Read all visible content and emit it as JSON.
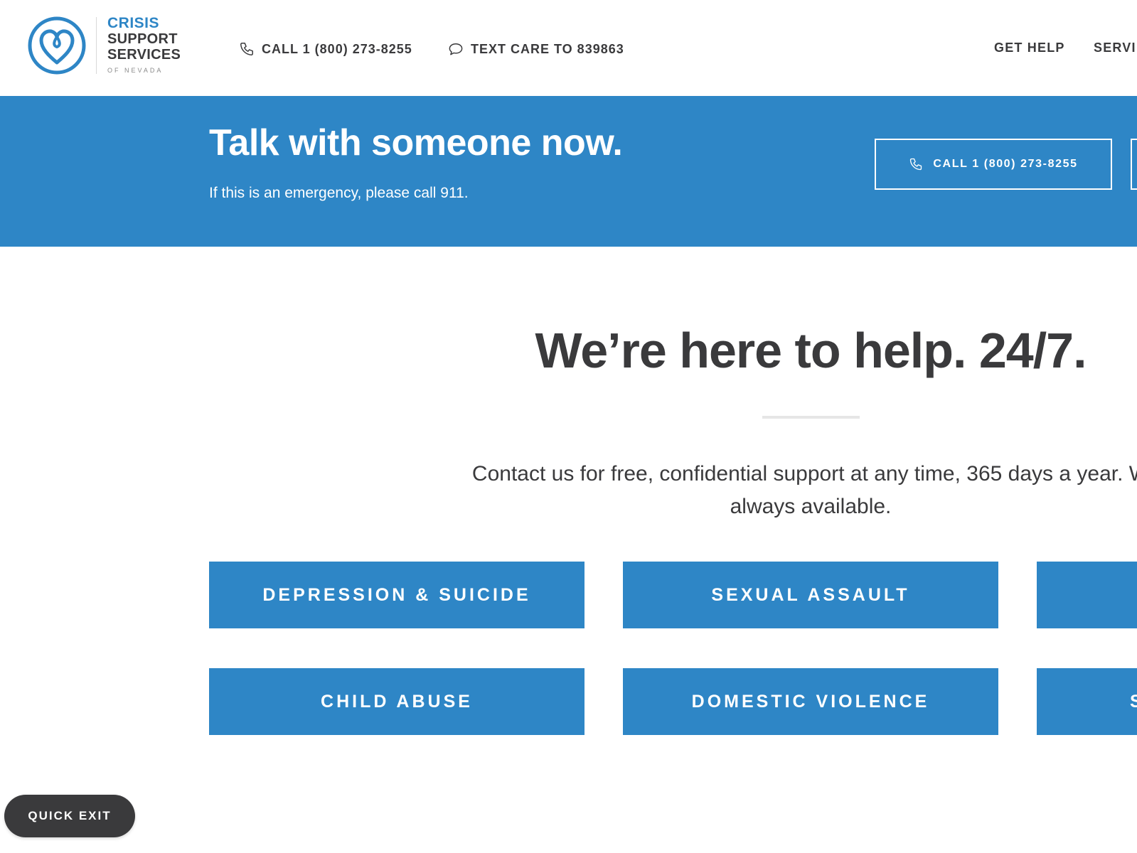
{
  "colors": {
    "brand_blue": "#2e86c6",
    "text_dark": "#3a3a3c",
    "white": "#ffffff",
    "divider": "#e6e6e6"
  },
  "logo": {
    "icon": "heart-circle-logo-icon",
    "line1": "CRISIS",
    "line2": "SUPPORT",
    "line3": "SERVICES",
    "line4": "OF NEVADA"
  },
  "header": {
    "call_icon": "phone-icon",
    "call_label": "CALL 1 (800) 273-8255",
    "text_icon": "chat-bubble-icon",
    "text_label": "TEXT CARE TO 839863",
    "nav": {
      "get_help": "GET HELP",
      "services": "SERVI"
    }
  },
  "banner": {
    "title": "Talk with someone now.",
    "subtitle": "If this is an emergency, please call 911.",
    "call_icon": "phone-icon",
    "call_button": "CALL 1 (800) 273-8255"
  },
  "main": {
    "title": "We’re here to help. 24/7.",
    "intro_line1": "Contact us for free, confidential support at any time, 365 days a year. W",
    "intro_line2": "always available.",
    "categories": [
      "DEPRESSION & SUICIDE",
      "SEXUAL ASSAULT",
      "",
      "CHILD ABUSE",
      "DOMESTIC VIOLENCE",
      "S"
    ]
  },
  "quick_exit": "QUICK EXIT"
}
